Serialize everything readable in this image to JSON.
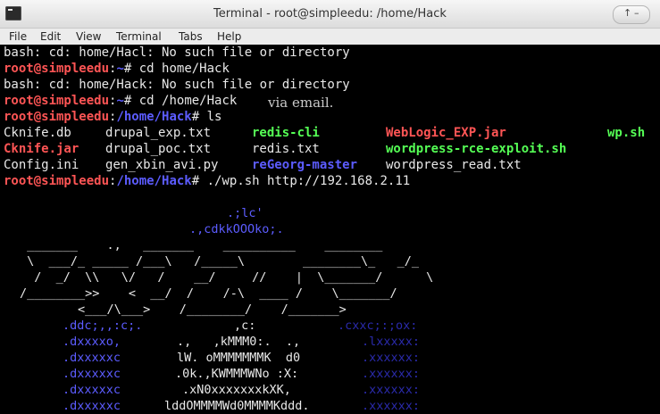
{
  "window": {
    "title": "Terminal - root@simpleedu: /home/Hack",
    "min_btn": "↑ –"
  },
  "menu": [
    "File",
    "Edit",
    "View",
    "Terminal",
    "Tabs",
    "Help"
  ],
  "lines": {
    "l1": "bash: cd: home/Hacl: No such file or directory",
    "l2_prompt": "root@simpleedu",
    "l2_path": "~",
    "l2_cmd": "# cd home/Hack",
    "l3": "bash: cd: home/Hack: No such file or directory",
    "l4_prompt": "root@simpleedu",
    "l4_path": "~",
    "l4_cmd": "# cd /home/Hack",
    "l5_prompt": "root@simpleedu",
    "l5_path": "/home/Hack",
    "l5_cmd": "# ls",
    "l9_prompt": "root@simpleedu",
    "l9_path": "/home/Hack",
    "l9_cmd": "# ./wp.sh http://192.168.2.11"
  },
  "overlay_text": "via email.",
  "files": {
    "r1": [
      "Cknife.db",
      "drupal_exp.txt",
      "redis-cli",
      "WebLogic_EXP.jar",
      "wp.sh"
    ],
    "r2": [
      "Cknife.jar",
      "drupal_poc.txt",
      "redis.txt",
      "wordpress-rce-exploit.sh"
    ],
    "r3": [
      "Config.ini",
      "gen_xbin_avi.py",
      "reGeorg-master",
      "wordpress_read.txt"
    ]
  },
  "banner": {
    "top1": ".;lc'",
    "top2": ".,cdkkOOOko;.",
    "logo1": " _______    .,   _______    __________    ________",
    "logo2": " \\  ___/_ _____ /___\\   /_____\\        ________\\_   _/_",
    "logo3": "  /  _/  \\\\   \\/   /    __/     //    |  \\_______/      \\",
    "logo4": "/________>>    <  __/  /    /-\\  ____ /    \\_______/",
    "logo5": "        <___/\\___>    /________/    /_______>",
    "left": [
      ".ddc;,,:c;.",
      ".dxxxxo,",
      ".dxxxxxc",
      ".dxxxxxc",
      ".dxxxxxc",
      ".dxxxxxc"
    ],
    "mid": [
      ",c:",
      ".,   ,kMMM0:.  .,",
      "lW. oMMMMMMMK  d0",
      ".0k.,KWMMMWNo :X:",
      ".xN0xxxxxxxkXK,",
      "lddOMMMMWd0MMMMKddd."
    ],
    "right": [
      ".cxxc;:;ox:",
      ".lxxxxx:",
      ".xxxxxx:",
      ".xxxxxx:",
      ".xxxxxx:",
      ".xxxxxx:"
    ]
  }
}
